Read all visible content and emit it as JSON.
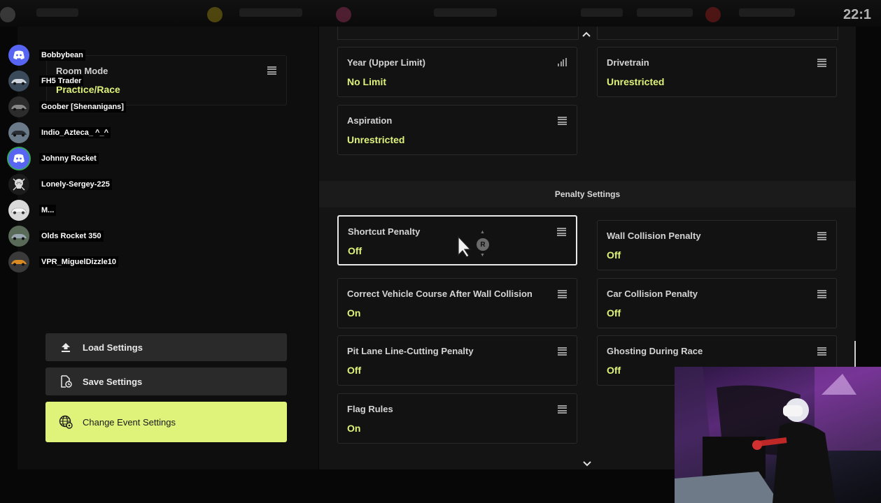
{
  "topbar": {
    "clock": "22:1"
  },
  "users": [
    {
      "name": "Bobbybean",
      "avatar": "discord-icon",
      "color": "#5865f2"
    },
    {
      "name": "FH5 Trader",
      "avatar": "car-avatar",
      "color": "#3a4a5a"
    },
    {
      "name": "Goober [Shenanigans]",
      "avatar": "car-avatar",
      "color": "#2c2c2c"
    },
    {
      "name": "Indio_Azteca_ ^_^",
      "avatar": "car-avatar",
      "color": "#6b7a88"
    },
    {
      "name": "Johnny Rocket",
      "avatar": "discord-icon",
      "color": "#5865f2"
    },
    {
      "name": "Lonely-Sergey-225",
      "avatar": "skull-avatar",
      "color": "#1c1c1c"
    },
    {
      "name": "M...",
      "avatar": "car-avatar",
      "color": "#d9d9d9"
    },
    {
      "name": "Olds Rocket 350",
      "avatar": "car-avatar",
      "color": "#5a6a58"
    },
    {
      "name": "VPR_MiguelDizzle10",
      "avatar": "car-avatar",
      "color": "#d98a20"
    }
  ],
  "room_mode": {
    "label": "Room Mode",
    "value": "Practice/Race"
  },
  "buttons": {
    "load": "Load Settings",
    "save": "Save Settings",
    "change": "Change Event Settings"
  },
  "settings_top": [
    {
      "label": "Year (Upper Limit)",
      "value": "No Limit",
      "icon": "signal-bars-icon"
    },
    {
      "label": "Drivetrain",
      "value": "Unrestricted",
      "icon": "menu-icon"
    },
    {
      "label": "Aspiration",
      "value": "Unrestricted",
      "icon": "menu-icon"
    }
  ],
  "penalty_section": {
    "title": "Penalty Settings"
  },
  "penalty_settings": [
    {
      "label": "Shortcut Penalty",
      "value": "Off"
    },
    {
      "label": "Wall Collision Penalty",
      "value": "Off"
    },
    {
      "label": "Correct Vehicle Course After Wall Collision",
      "value": "On"
    },
    {
      "label": "Car Collision Penalty",
      "value": "Off"
    },
    {
      "label": "Pit Lane Line-Cutting Penalty",
      "value": "Off"
    },
    {
      "label": "Ghosting During Race",
      "value": "Off"
    },
    {
      "label": "Flag Rules",
      "value": "On"
    }
  ],
  "r_button": "R",
  "colors": {
    "accent": "#dff27a",
    "panel": "#141414",
    "discord": "#5865f2"
  }
}
